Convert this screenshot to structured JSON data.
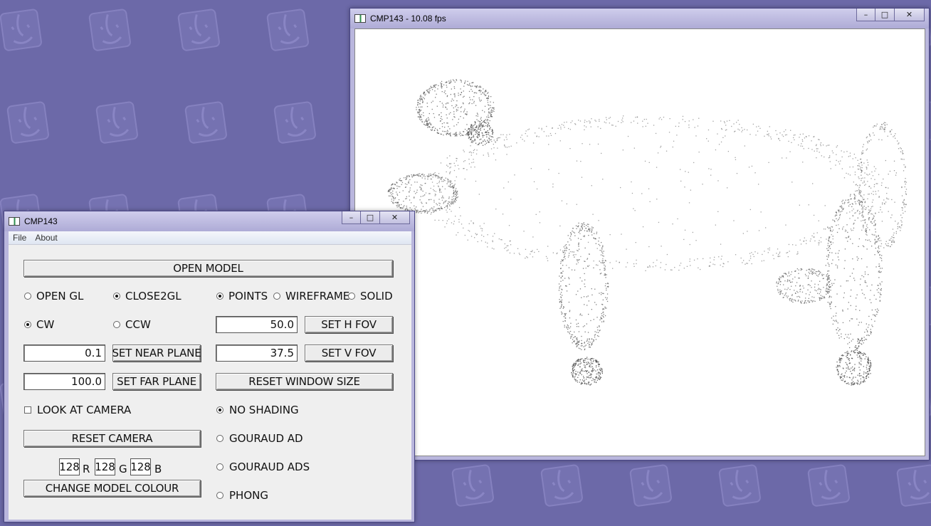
{
  "render_window": {
    "title": "CMP143 - 10.08 fps",
    "controls": {
      "minimize": "–",
      "maximize": "□",
      "close": "✕"
    }
  },
  "control_window": {
    "title": "CMP143",
    "controls": {
      "minimize": "–",
      "maximize": "□",
      "close": "✕"
    },
    "menu": [
      "File",
      "About"
    ],
    "open_model_label": "OPEN MODEL",
    "engine_options": [
      {
        "label": "OPEN GL",
        "selected": false
      },
      {
        "label": "CLOSE2GL",
        "selected": true
      }
    ],
    "render_mode_options": [
      {
        "label": "POINTS",
        "selected": true
      },
      {
        "label": "WIREFRAME",
        "selected": false
      },
      {
        "label": "SOLID",
        "selected": false
      }
    ],
    "winding_options": [
      {
        "label": "CW",
        "selected": true
      },
      {
        "label": "CCW",
        "selected": false
      }
    ],
    "h_fov": {
      "value": "50.0",
      "button": "SET H FOV"
    },
    "v_fov": {
      "value": "37.5",
      "button": "SET V FOV"
    },
    "near_plane": {
      "value": "0.1",
      "button": "SET NEAR PLANE"
    },
    "far_plane": {
      "value": "100.0",
      "button": "SET FAR PLANE"
    },
    "reset_window_size_label": "RESET WINDOW SIZE",
    "look_at_camera": {
      "label": "LOOK AT CAMERA",
      "checked": false
    },
    "reset_camera_label": "RESET CAMERA",
    "shading_options": [
      {
        "label": "NO SHADING",
        "selected": true
      },
      {
        "label": "GOURAUD AD",
        "selected": false
      },
      {
        "label": "GOURAUD ADS",
        "selected": false
      },
      {
        "label": "PHONG",
        "selected": false
      }
    ],
    "colour": {
      "r": "128",
      "r_label": "R",
      "g": "128",
      "g_label": "G",
      "b": "128",
      "b_label": "B"
    },
    "change_colour_label": "CHANGE MODEL COLOUR"
  },
  "colors": {
    "desktop": "#6c69a8",
    "window_frame": "#b9b6dd",
    "panel": "#efefef",
    "point_cloud": "#555555"
  },
  "icons": [
    "finder-logo-icon",
    "app-icon",
    "minimize-icon",
    "maximize-icon",
    "close-icon"
  ]
}
